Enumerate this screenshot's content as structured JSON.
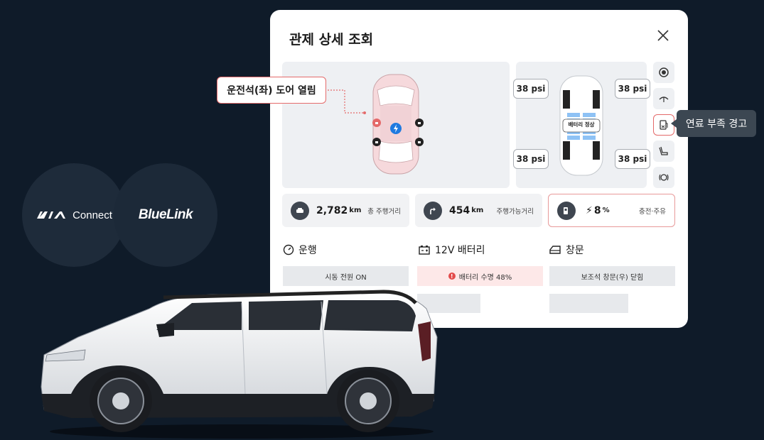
{
  "brands": {
    "kia_mark": "KIA",
    "kia_connect": "Connect",
    "bluelink": "BlueLink"
  },
  "panel": {
    "title": "관제 상세 조회",
    "door_callout": "운전석(좌) 도어 열림",
    "battery_status": "배터리 정상",
    "tire_pressures": {
      "front_left": "38 psi",
      "front_right": "38 psi",
      "rear_left": "38 psi",
      "rear_right": "38 psi"
    },
    "tooltip": "연료 부족 경고",
    "stats": {
      "mileage": {
        "value": "2,782",
        "unit": "km",
        "label": "총 주행거리"
      },
      "range": {
        "value": "454",
        "unit": "km",
        "label": "주행가능거리"
      },
      "charge": {
        "value": "8",
        "unit": "%",
        "label": "충전·주유"
      }
    },
    "sections": {
      "drive": {
        "title": "운행",
        "status": "시동 전원 ON"
      },
      "battery12v": {
        "title": "12V 배터리",
        "status": "배터리 수명 48%"
      },
      "window": {
        "title": "창문",
        "status": "보조석 창문(우) 닫힘"
      }
    }
  },
  "colors": {
    "background": "#0f1b29",
    "alert": "#e46a6a",
    "accent_blue": "#1f7ae0"
  }
}
